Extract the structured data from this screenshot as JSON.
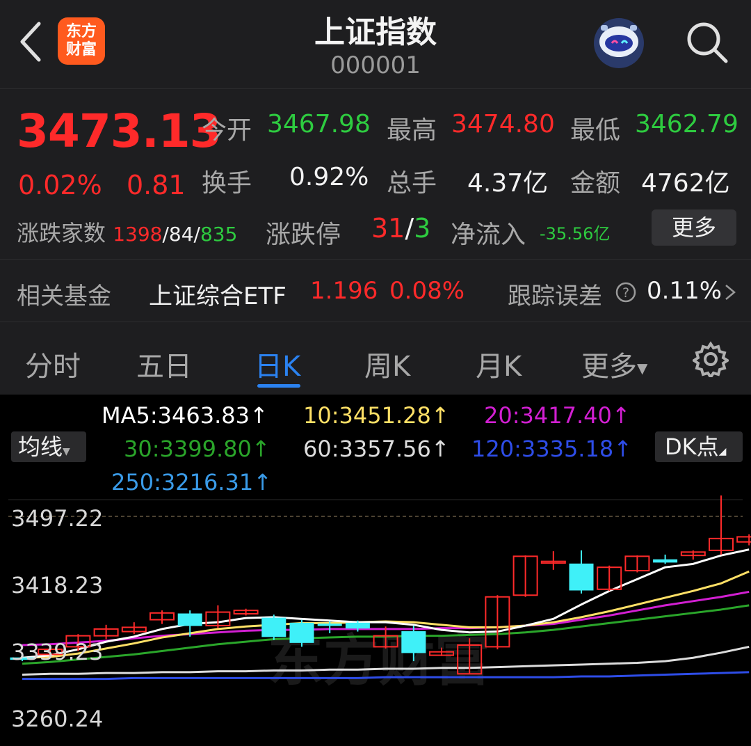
{
  "header": {
    "title": "上证指数",
    "code": "000001",
    "logo_line1": "东方",
    "logo_line2": "财富"
  },
  "quote": {
    "price": "3473.13",
    "change_pct": "0.02%",
    "change": "0.81",
    "open_label": "今开",
    "open": "3467.98",
    "high_label": "最高",
    "high": "3474.80",
    "low_label": "最低",
    "low": "3462.79",
    "turnover_label": "换手",
    "turnover": "0.92%",
    "volume_label": "总手",
    "volume": "4.37亿",
    "amount_label": "金额",
    "amount": "4762亿",
    "breadth_label": "涨跌家数",
    "up_count": "1398",
    "flat_count": "84",
    "down_count": "835",
    "limit_label": "涨跌停",
    "limit_up": "31",
    "limit_down": "3",
    "netflow_label": "净流入",
    "netflow": "-35.56亿",
    "more_label": "更多"
  },
  "fund": {
    "label": "相关基金",
    "name": "上证综合ETF",
    "price": "1.196",
    "pct": "0.08%",
    "error_label": "跟踪误差",
    "error_value": "0.11%"
  },
  "tabs": [
    "分时",
    "五日",
    "日K",
    "周K",
    "月K",
    "更多"
  ],
  "active_tab": "日K",
  "chart_controls": {
    "ma_select": "均线",
    "dk_button": "DK点"
  },
  "ma_labels": {
    "ma5": "MA5:3463.83↑",
    "ma10": "10:3451.28↑",
    "ma20": "20:3417.40↑",
    "ma30": "30:3399.80↑",
    "ma60": "60:3357.56↑",
    "ma120": "120:3335.18↑",
    "ma250": "250:3216.31↑"
  },
  "colors": {
    "up": "#ff2a2a",
    "down": "#3ff0f8",
    "ma5": "#ffffff",
    "ma10": "#ffe066",
    "ma20": "#d21fd2",
    "ma30": "#2aa52a",
    "ma60": "#dcdcdc",
    "ma120": "#2e4de8",
    "ma250": "#3a9be8",
    "active_tab": "#2b82f0"
  },
  "watermark": "东方财富",
  "chart_data": {
    "type": "candlestick",
    "y_ticks": [
      "3497.22",
      "3418.23",
      "3339.23",
      "3260.24"
    ],
    "ylim": [
      3260.24,
      3497.22
    ],
    "candles": [
      {
        "o": 3330,
        "c": 3328,
        "h": 3334,
        "l": 3326
      },
      {
        "o": 3334,
        "c": 3340,
        "h": 3343,
        "l": 3331
      },
      {
        "o": 3343,
        "c": 3356,
        "h": 3358,
        "l": 3338
      },
      {
        "o": 3356,
        "c": 3364,
        "h": 3369,
        "l": 3352
      },
      {
        "o": 3361,
        "c": 3366,
        "h": 3372,
        "l": 3358
      },
      {
        "o": 3375,
        "c": 3383,
        "h": 3386,
        "l": 3370
      },
      {
        "o": 3382,
        "c": 3368,
        "h": 3386,
        "l": 3355
      },
      {
        "o": 3368,
        "c": 3384,
        "h": 3392,
        "l": 3365
      },
      {
        "o": 3382,
        "c": 3386,
        "h": 3388,
        "l": 3380
      },
      {
        "o": 3377,
        "c": 3355,
        "h": 3381,
        "l": 3351
      },
      {
        "o": 3371,
        "c": 3348,
        "h": 3375,
        "l": 3343
      },
      {
        "o": 3370,
        "c": 3368,
        "h": 3373,
        "l": 3359
      },
      {
        "o": 3371,
        "c": 3365,
        "h": 3374,
        "l": 3361
      },
      {
        "o": 3343,
        "c": 3356,
        "h": 3367,
        "l": 3341
      },
      {
        "o": 3361,
        "c": 3336,
        "h": 3368,
        "l": 3326
      },
      {
        "o": 3333,
        "c": 3337,
        "h": 3342,
        "l": 3332
      },
      {
        "o": 3311,
        "c": 3345,
        "h": 3353,
        "l": 3311
      },
      {
        "o": 3343,
        "c": 3402,
        "h": 3404,
        "l": 3340
      },
      {
        "o": 3404,
        "c": 3450,
        "h": 3451,
        "l": 3402
      },
      {
        "o": 3442,
        "c": 3444,
        "h": 3456,
        "l": 3434
      },
      {
        "o": 3441,
        "c": 3410,
        "h": 3457,
        "l": 3406
      },
      {
        "o": 3411,
        "c": 3437,
        "h": 3439,
        "l": 3409
      },
      {
        "o": 3433,
        "c": 3450,
        "h": 3451,
        "l": 3431
      },
      {
        "o": 3446,
        "c": 3443,
        "h": 3452,
        "l": 3441
      },
      {
        "o": 3451,
        "c": 3455,
        "h": 3457,
        "l": 3446
      },
      {
        "o": 3457,
        "c": 3471,
        "h": 3523,
        "l": 3452
      },
      {
        "o": 3467,
        "c": 3473,
        "h": 3476,
        "l": 3463
      }
    ],
    "ma5": [
      3330,
      3333,
      3340,
      3349,
      3355,
      3364,
      3370,
      3372,
      3377,
      3378,
      3376,
      3374,
      3372,
      3372,
      3369,
      3363,
      3360,
      3361,
      3368,
      3376,
      3393,
      3409,
      3423,
      3437,
      3441,
      3451,
      3458
    ],
    "ma10": [
      3330,
      3331,
      3335,
      3341,
      3347,
      3354,
      3359,
      3364,
      3367,
      3369,
      3371,
      3371,
      3372,
      3373,
      3372,
      3369,
      3366,
      3366,
      3368,
      3372,
      3378,
      3385,
      3393,
      3401,
      3409,
      3418,
      3432
    ],
    "ma20": [
      3345,
      3346,
      3348,
      3350,
      3353,
      3356,
      3358,
      3360,
      3362,
      3363,
      3363,
      3364,
      3364,
      3364,
      3364,
      3365,
      3365,
      3366,
      3368,
      3370,
      3375,
      3380,
      3386,
      3392,
      3397,
      3402,
      3408
    ],
    "ma30": [
      3323,
      3325,
      3328,
      3331,
      3334,
      3338,
      3342,
      3346,
      3349,
      3352,
      3353,
      3354,
      3355,
      3355,
      3356,
      3356,
      3357,
      3358,
      3360,
      3363,
      3367,
      3371,
      3375,
      3379,
      3383,
      3387,
      3392
    ],
    "ma60": [
      3310,
      3311,
      3311,
      3312,
      3312,
      3313,
      3313,
      3314,
      3314,
      3315,
      3315,
      3316,
      3316,
      3317,
      3317,
      3318,
      3318,
      3319,
      3320,
      3321,
      3322,
      3323,
      3324,
      3326,
      3330,
      3336,
      3343
    ],
    "ma120": [
      3305,
      3305,
      3305,
      3305,
      3306,
      3306,
      3306,
      3306,
      3306,
      3306,
      3306,
      3306,
      3306,
      3307,
      3307,
      3307,
      3307,
      3307,
      3307,
      3307,
      3308,
      3308,
      3309,
      3310,
      3311,
      3312,
      3313
    ]
  }
}
